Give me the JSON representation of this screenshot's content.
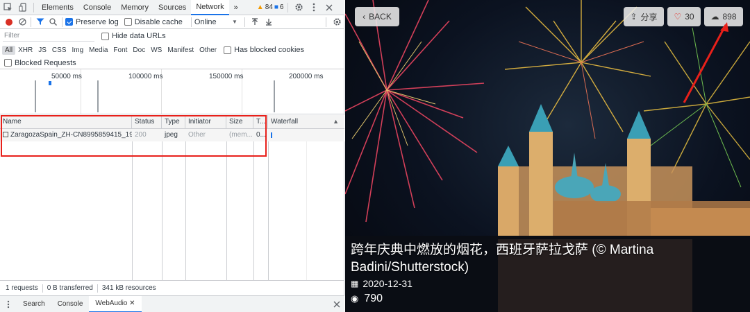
{
  "devtools": {
    "tabs": [
      "Elements",
      "Console",
      "Memory",
      "Sources",
      "Network"
    ],
    "active_tab": "Network",
    "more": "»",
    "warnings_count": "84",
    "messages_count": "6",
    "toolbar": {
      "preserve_log": "Preserve log",
      "disable_cache": "Disable cache",
      "throttle": "Online"
    },
    "filter": {
      "placeholder": "Filter",
      "hide_data_urls": "Hide data URLs"
    },
    "types": [
      "All",
      "XHR",
      "JS",
      "CSS",
      "Img",
      "Media",
      "Font",
      "Doc",
      "WS",
      "Manifest",
      "Other"
    ],
    "has_blocked_cookies": "Has blocked cookies",
    "blocked_requests": "Blocked Requests",
    "overview_ticks": [
      "50000 ms",
      "100000 ms",
      "150000 ms",
      "200000 ms"
    ],
    "columns": [
      "Name",
      "Status",
      "Type",
      "Initiator",
      "Size",
      "T...",
      "Waterfall"
    ],
    "rows": [
      {
        "name": "ZaragozaSpain_ZH-CN8995859415_19...",
        "status": "200",
        "type": "jpeg",
        "initiator": "Other",
        "size": "(mem...",
        "time": "0..."
      }
    ],
    "status": {
      "requests": "1 requests",
      "transferred": "0 B transferred",
      "resources": "341 kB resources"
    },
    "drawer_tabs": [
      "Search",
      "Console",
      "WebAudio"
    ],
    "drawer_active": "WebAudio"
  },
  "viewer": {
    "back": "BACK",
    "share": "分享",
    "likes": "30",
    "downloads": "898",
    "caption": "跨年庆典中燃放的烟花，西班牙萨拉戈萨 (© Martina Badini/Shutterstock)",
    "date": "2020-12-31",
    "views": "790",
    "accent": "#e8201a"
  }
}
